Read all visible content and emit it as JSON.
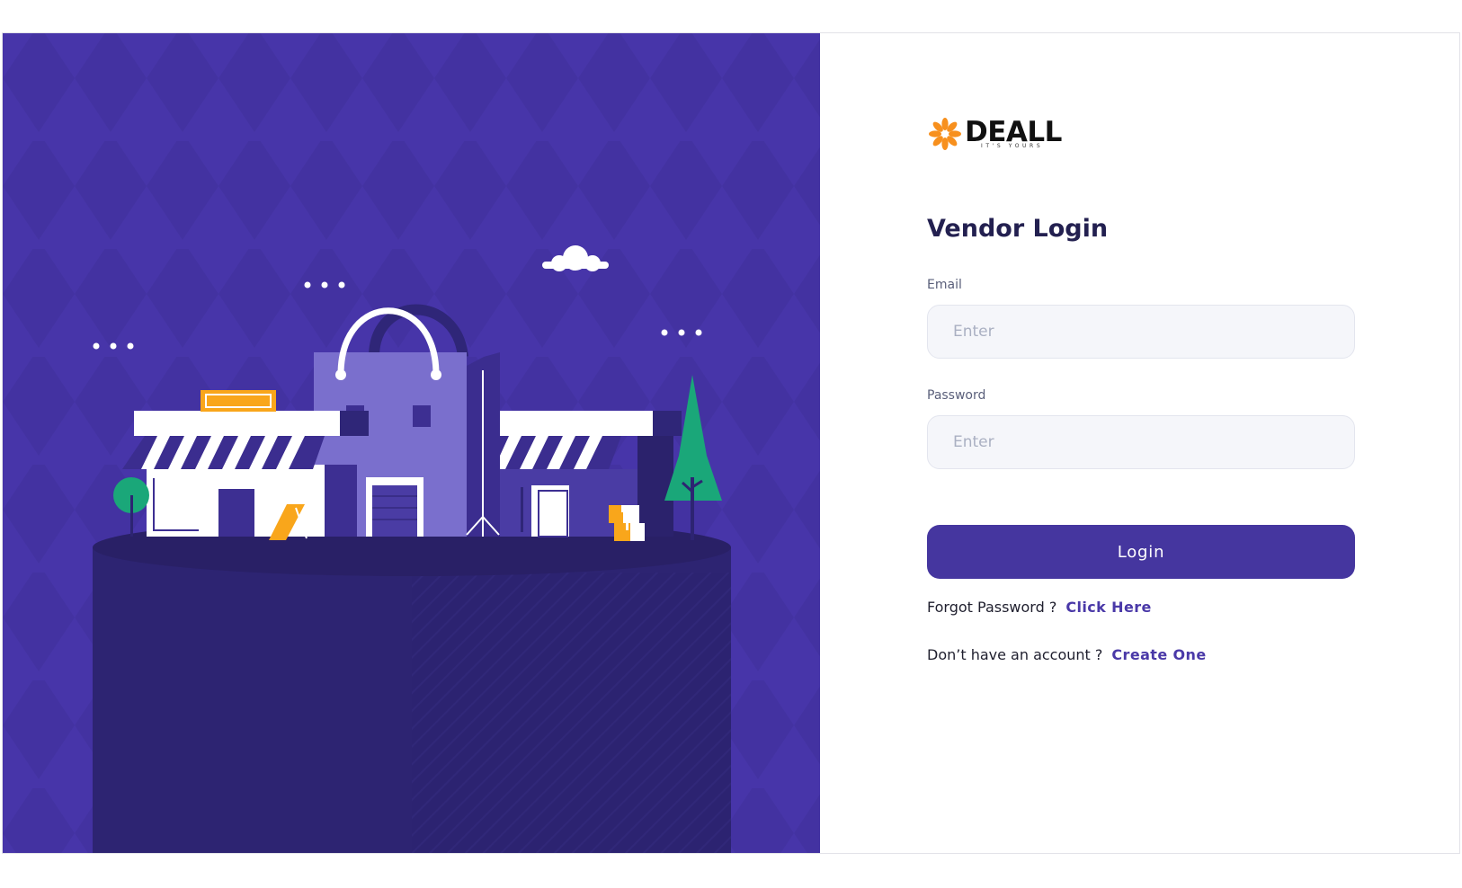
{
  "brand": {
    "name": "DEALL",
    "tagline": "IT'S YOURS",
    "colors": {
      "primary": "#45369f",
      "accent": "#f7901e",
      "hero_bg": "#4735a9"
    }
  },
  "illustration": {
    "subject": "storefront-with-shopping-bag",
    "icons": [
      "cloud-icon",
      "tree-icon",
      "shopping-bag-icon",
      "boxes-icon"
    ]
  },
  "login": {
    "title": "Vendor Login",
    "email_label": "Email",
    "email_placeholder": "Enter",
    "email_value": "",
    "password_label": "Password",
    "password_placeholder": "Enter",
    "password_value": "",
    "submit_label": "Login"
  },
  "links": {
    "forgot_text": "Forgot Password ?",
    "forgot_link": "Click Here",
    "signup_text": "Don’t have an account ?",
    "signup_link": "Create One"
  }
}
